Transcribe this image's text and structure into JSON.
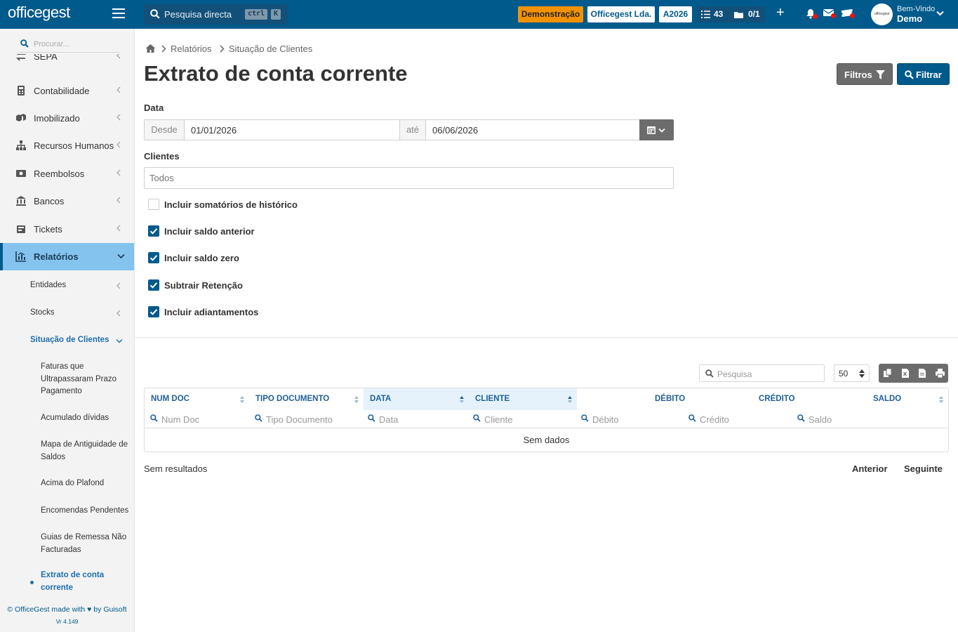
{
  "topbar": {
    "logo": "officegest",
    "search_placeholder": "Pesquisa directa",
    "shortcut_ctrl": "ctrl",
    "shortcut_key": "K",
    "demo_badge": "Demonstração",
    "company_badge": "Officegest Lda.",
    "year_badge": "A2026",
    "tasks_count": "43",
    "docs_count": "0/1",
    "welcome": "Bem-Vindo",
    "user": "Demo",
    "avatar_text": "officegest"
  },
  "sidebar": {
    "search_placeholder": "Procurar...",
    "items": [
      {
        "label": "SEPA",
        "icon": "exchange-icon"
      },
      {
        "label": "Contabilidade",
        "icon": "calculator-icon"
      },
      {
        "label": "Imobilizado",
        "icon": "boxes-icon"
      },
      {
        "label": "Recursos Humanos",
        "icon": "sitemap-icon"
      },
      {
        "label": "Reembolsos",
        "icon": "money-bill-icon"
      },
      {
        "label": "Bancos",
        "icon": "bank-icon"
      },
      {
        "label": "Tickets",
        "icon": "ticket-icon"
      },
      {
        "label": "Relatórios",
        "icon": "chart-icon"
      }
    ],
    "sub_items": [
      {
        "label": "Entidades"
      },
      {
        "label": "Stocks"
      },
      {
        "label": "Situação de Clientes"
      }
    ],
    "subsub_items": [
      {
        "label": "Faturas que Ultrapassaram Prazo Pagamento"
      },
      {
        "label": "Acumulado dívidas"
      },
      {
        "label": "Mapa de Antiguidade de Saldos"
      },
      {
        "label": "Acima do Plafond"
      },
      {
        "label": "Encomendas Pendentes"
      },
      {
        "label": "Guias de Remessa Não Facturadas"
      },
      {
        "label": "Extrato de conta corrente"
      }
    ],
    "footer": "© OfficeGest made with ♥ by Guisoft",
    "version": "Vr 4.149"
  },
  "breadcrumb": {
    "level1": "Relatórios",
    "level2": "Situação de Clientes"
  },
  "page": {
    "title": "Extrato de conta corrente",
    "filtros_button": "Filtros",
    "filtrar_button": "Filtrar"
  },
  "form": {
    "data_label": "Data",
    "desde_label": "Desde",
    "from_date": "01/01/2026",
    "ate_label": "até",
    "to_date": "06/06/2026",
    "clientes_label": "Clientes",
    "clientes_placeholder": "Todos",
    "checkboxes": [
      {
        "label": "Incluir somatórios de histórico",
        "checked": false
      },
      {
        "label": "Incluir saldo anterior",
        "checked": true
      },
      {
        "label": "Incluir saldo zero",
        "checked": true
      },
      {
        "label": "Subtrair Retenção",
        "checked": true
      },
      {
        "label": "Incluir adiantamentos",
        "checked": true
      }
    ]
  },
  "table": {
    "search_placeholder": "Pesquisa",
    "page_size": "50",
    "columns": [
      {
        "label": "NUM DOC",
        "filter": "Num Doc"
      },
      {
        "label": "TIPO DOCUMENTO",
        "filter": "Tipo Documento"
      },
      {
        "label": "DATA",
        "filter": "Data"
      },
      {
        "label": "CLIENTE",
        "filter": "Cliente"
      },
      {
        "label": "DÉBITO",
        "filter": "Débito"
      },
      {
        "label": "CRÉDITO",
        "filter": "Crédito"
      },
      {
        "label": "SALDO",
        "filter": "Saldo"
      }
    ],
    "empty_text": "Sem dados",
    "results_text": "Sem resultados",
    "prev": "Anterior",
    "next": "Seguinte"
  },
  "colors": {
    "brand": "#005a8c",
    "accent_orange": "#f39200",
    "active_sidebar": "#84c3ee",
    "link": "#1e6fae"
  }
}
